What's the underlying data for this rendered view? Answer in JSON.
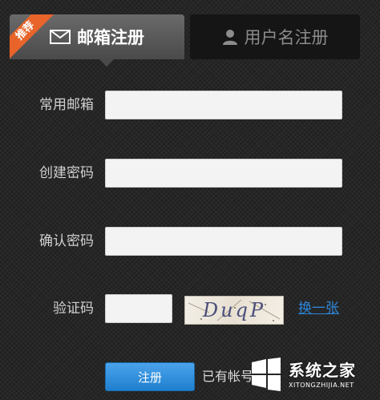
{
  "tabs": {
    "email": {
      "label": "邮箱注册",
      "icon": "envelope-icon"
    },
    "username": {
      "label": "用户名注册",
      "icon": "user-icon"
    },
    "badge": "推荐"
  },
  "form": {
    "email_label": "常用邮箱",
    "email_value": "",
    "password_label": "创建密码",
    "password_value": "",
    "confirm_label": "确认密码",
    "confirm_value": "",
    "captcha_label": "验证码",
    "captcha_value": "",
    "captcha_text": "DuqP",
    "refresh_label": "换一张",
    "submit_label": "注册",
    "login_hint": "已有帐号"
  },
  "watermark": {
    "title": "系统之家",
    "url": "XITONGZHIJIA.NET"
  },
  "colors": {
    "background": "#262626",
    "active_tab": "#5a5a5a",
    "inactive_tab": "#151515",
    "badge": "#e8642a",
    "link": "#2e86d8",
    "submit": "#1f7fcf"
  }
}
